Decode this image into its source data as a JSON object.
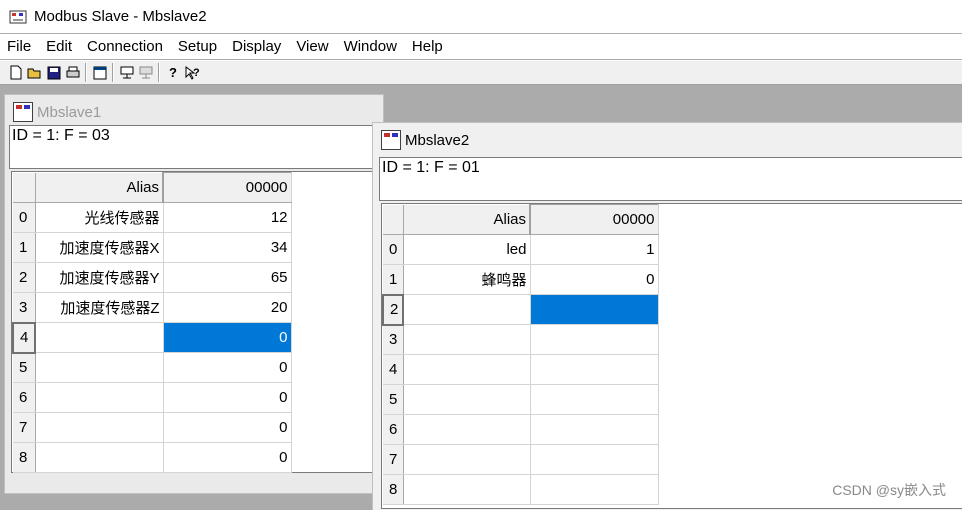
{
  "app": {
    "title": "Modbus Slave - Mbslave2"
  },
  "menu": [
    "File",
    "Edit",
    "Connection",
    "Setup",
    "Display",
    "View",
    "Window",
    "Help"
  ],
  "toolbar": {
    "buttons": [
      "new-icon",
      "open-icon",
      "save-icon",
      "print-icon",
      "window-icon",
      "connect-icon",
      "disconnect-icon",
      "help-icon",
      "context-help-icon"
    ]
  },
  "windows": [
    {
      "title": "Mbslave1",
      "info": "ID = 1: F = 03",
      "columns": {
        "alias": "Alias",
        "addr": "00000"
      },
      "rows": [
        {
          "n": "0",
          "alias": "光线传感器",
          "val": "12"
        },
        {
          "n": "1",
          "alias": "加速度传感器X",
          "val": "34"
        },
        {
          "n": "2",
          "alias": "加速度传感器Y",
          "val": "65"
        },
        {
          "n": "3",
          "alias": "加速度传感器Z",
          "val": "20"
        },
        {
          "n": "4",
          "alias": "",
          "val": "0"
        },
        {
          "n": "5",
          "alias": "",
          "val": "0"
        },
        {
          "n": "6",
          "alias": "",
          "val": "0"
        },
        {
          "n": "7",
          "alias": "",
          "val": "0"
        },
        {
          "n": "8",
          "alias": "",
          "val": "0"
        }
      ]
    },
    {
      "title": "Mbslave2",
      "info": "ID = 1: F = 01",
      "columns": {
        "alias": "Alias",
        "addr": "00000"
      },
      "rows": [
        {
          "n": "0",
          "alias": "led",
          "val": "1"
        },
        {
          "n": "1",
          "alias": "蜂鸣器",
          "val": "0"
        },
        {
          "n": "2",
          "alias": "",
          "val": ""
        },
        {
          "n": "3",
          "alias": "",
          "val": ""
        },
        {
          "n": "4",
          "alias": "",
          "val": ""
        },
        {
          "n": "5",
          "alias": "",
          "val": ""
        },
        {
          "n": "6",
          "alias": "",
          "val": ""
        },
        {
          "n": "7",
          "alias": "",
          "val": ""
        },
        {
          "n": "8",
          "alias": "",
          "val": ""
        }
      ]
    }
  ],
  "watermark": "CSDN @sy嵌入式",
  "colors": {
    "selection": "#0078d7"
  }
}
